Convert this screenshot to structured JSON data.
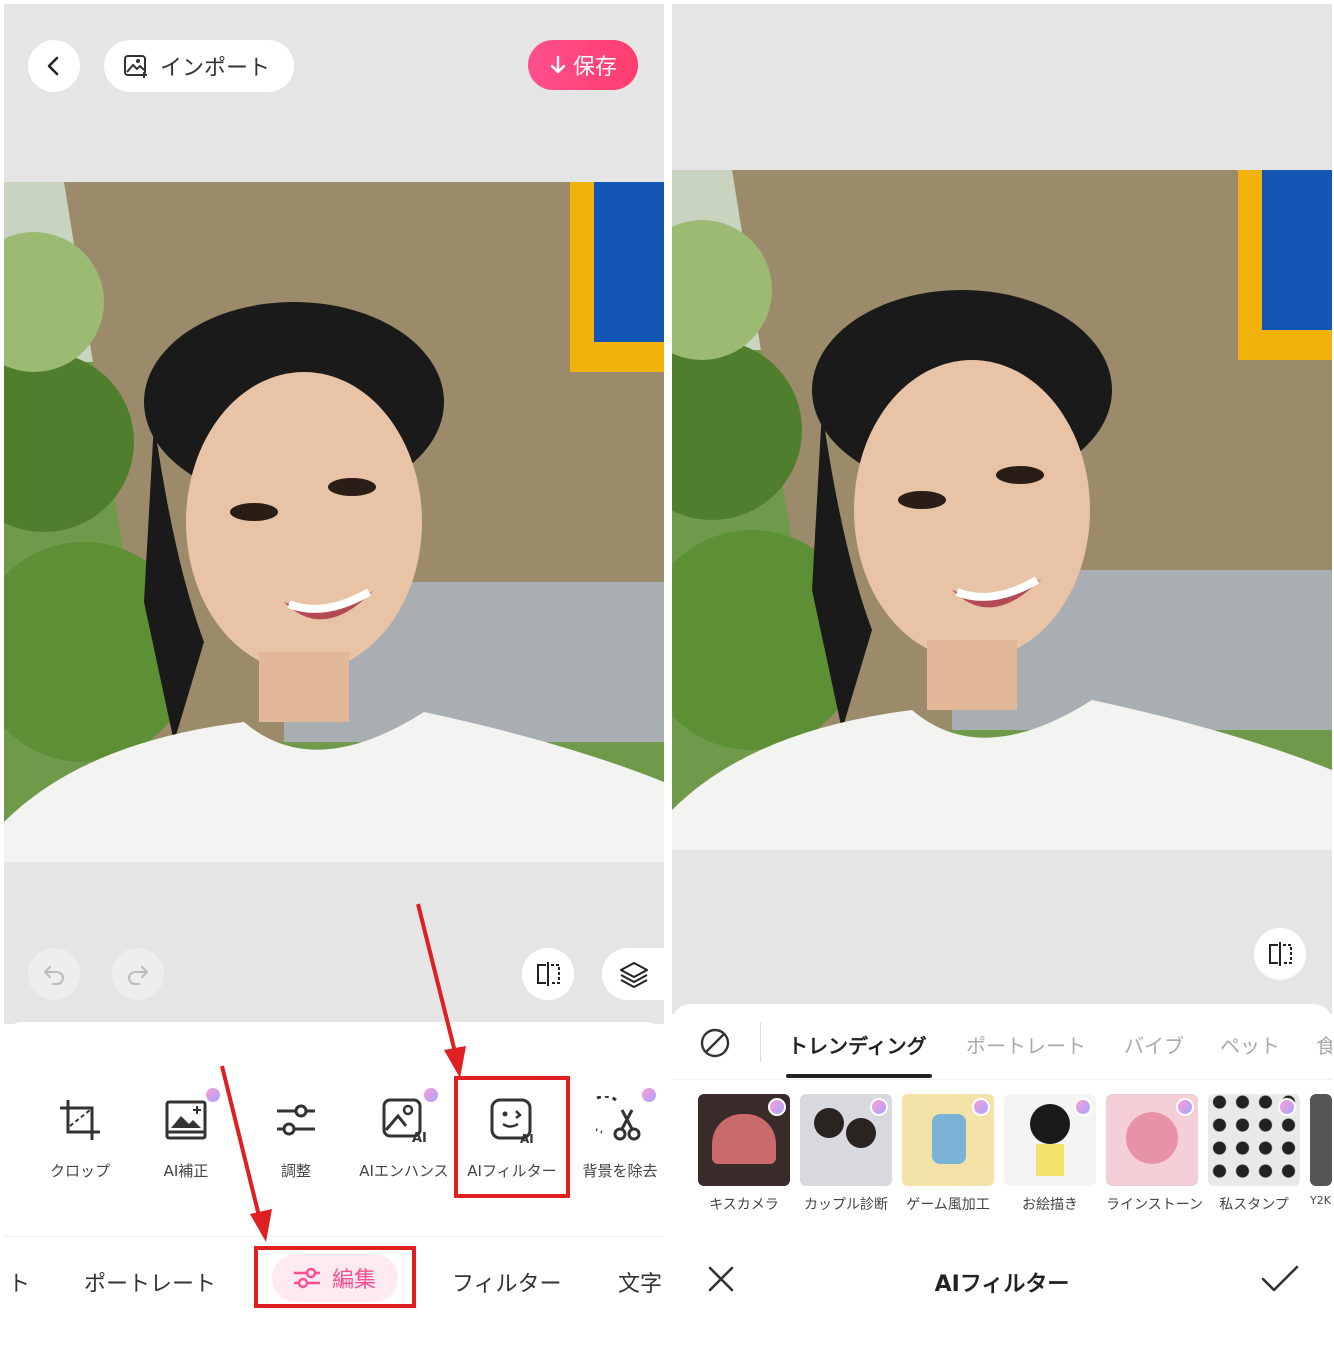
{
  "left": {
    "header": {
      "import_label": "インポート",
      "save_label": "保存"
    },
    "tools": [
      {
        "label": "クロップ",
        "icon": "crop-icon"
      },
      {
        "label": "AI補正",
        "icon": "ai-enhance-photo-icon"
      },
      {
        "label": "調整",
        "icon": "adjust-sliders-icon"
      },
      {
        "label": "AIエンハンス",
        "icon": "ai-enhance-icon"
      },
      {
        "label": "AIフィルター",
        "icon": "ai-filter-face-icon"
      },
      {
        "label": "背景を除去",
        "icon": "remove-background-scissors-icon"
      }
    ],
    "nav": {
      "partial": "ト",
      "portrait": "ポートレート",
      "edit": "編集",
      "filter": "フィルター",
      "text": "文字"
    }
  },
  "right": {
    "categories": [
      "トレンディング",
      "ポートレート",
      "バイブ",
      "ペット",
      "食"
    ],
    "active_category": "トレンディング",
    "filters": [
      {
        "label": "キスカメラ",
        "color": "#3a2a2a"
      },
      {
        "label": "カップル診断",
        "color": "#d7d9de"
      },
      {
        "label": "ゲーム風加工",
        "color": "#f3e3a8"
      },
      {
        "label": "お絵描き",
        "color": "#f4f4f4"
      },
      {
        "label": "ラインストーン",
        "color": "#f5cfd8"
      },
      {
        "label": "私スタンプ",
        "color": "#e9e9e9"
      },
      {
        "label": "Y2K",
        "color": "#555555"
      }
    ],
    "title": "AIフィルター"
  },
  "colors": {
    "accent": "#ff4f8e",
    "annotation": "#e02020",
    "canvas": "#e5e5e5"
  }
}
